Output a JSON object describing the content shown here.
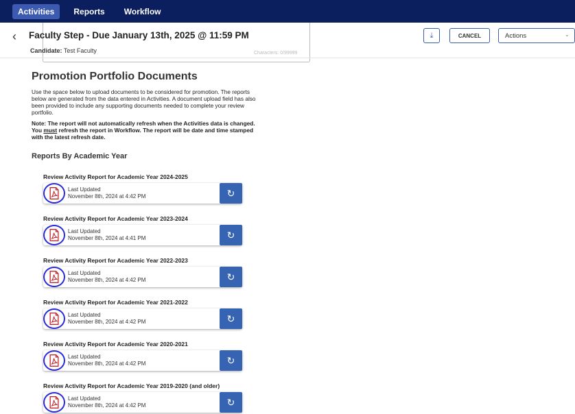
{
  "nav": {
    "items": [
      {
        "label": "Activities",
        "active": true
      },
      {
        "label": "Reports",
        "active": false
      },
      {
        "label": "Workflow",
        "active": false
      }
    ]
  },
  "header": {
    "back_icon": "chevron-left-icon",
    "title": "Faculty Step - Due January 13th, 2025 @ 11:59 PM",
    "candidate_label": "Candidate:",
    "candidate_value": "Test Faculty",
    "char_count": "Characters: 0/99999",
    "download_icon": "download-icon",
    "cancel_label": "CANCEL",
    "actions_label": "Actions",
    "actions_icon": "chevron-down-icon"
  },
  "main": {
    "section_title": "Promotion Portfolio Documents",
    "intro": "Use the space below to upload documents to be considered for promotion. The reports below are generated from the data entered in Activities. A document upload field has also been provided to include any supporting documents needed to complete your review portfolio.",
    "note_a": "Note: The report will not automatically refresh when the Activities data is changed. You ",
    "note_must": "must",
    "note_b": " refresh the report in Workflow. The report will be date and time stamped with the latest refresh date.",
    "reports_heading": "Reports By Academic Year"
  },
  "reports": [
    {
      "title": "Review Activity Report for Academic Year 2024-2025",
      "label": "Last Updated",
      "date": "November 8th, 2024 at 4:42 PM"
    },
    {
      "title": "Review Activity Report for Academic Year 2023-2024",
      "label": "Last Updated",
      "date": "November 8th, 2024 at 4:41 PM"
    },
    {
      "title": "Review Activity Report for Academic Year 2022-2023",
      "label": "Last Updated",
      "date": "November 8th, 2024 at 4:42 PM"
    },
    {
      "title": "Review Activity Report for Academic Year 2021-2022",
      "label": "Last Updated",
      "date": "November 8th, 2024 at 4:42 PM"
    },
    {
      "title": "Review Activity Report for Academic Year 2020-2021",
      "label": "Last Updated",
      "date": "November 8th, 2024 at 4:42 PM"
    },
    {
      "title": "Review Activity Report for Academic Year 2019-2020 (and older)",
      "label": "Last Updated",
      "date": "November 8th, 2024 at 4:42 PM"
    }
  ],
  "colors": {
    "nav_bg": "#0b1e5e",
    "nav_active": "#3d5ab1",
    "button_blue": "#3664b2",
    "pdf_red": "#c0262d",
    "highlight_circle": "#2b2ad6"
  }
}
